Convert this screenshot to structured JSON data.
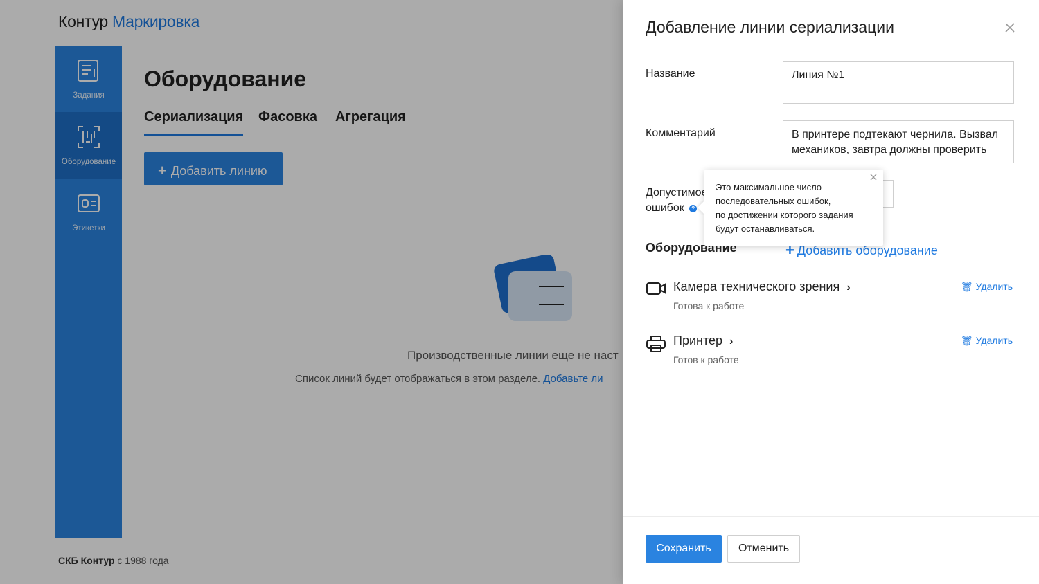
{
  "background": {
    "logo": {
      "brand": "Контур",
      "product": "Маркировка"
    },
    "sidebar": {
      "items": [
        {
          "label": "Задания",
          "icon": "tasks-icon"
        },
        {
          "label": "Оборудование",
          "icon": "equipment-icon"
        },
        {
          "label": "Этикетки",
          "icon": "labels-icon"
        }
      ],
      "active_index": 1
    },
    "page_title": "Оборудование",
    "tabs": [
      {
        "label": "Сериализация"
      },
      {
        "label": "Фасовка"
      },
      {
        "label": "Агрегация"
      }
    ],
    "add_line_button": "Добавить линию",
    "empty_state": {
      "title": "Производственные линии еще не наст",
      "subtitle": "Список линий будет отображаться в этом разделе.",
      "link": "Добавьте ли"
    },
    "footer": {
      "company": "СКБ Контур",
      "since": "с 1988 года"
    }
  },
  "panel": {
    "title": "Добавление линии сериализации",
    "fields": {
      "name": {
        "label": "Название",
        "value": "Линия №1"
      },
      "comment": {
        "label": "Комментарий",
        "value": "В принтере подтекают чернила. Вызвал механиков, завтра должны проверить"
      },
      "errors": {
        "label_line1": "Допустимое",
        "label_line2": "ошибок",
        "help_glyph": "?"
      }
    },
    "tooltip": {
      "lines": [
        "Это максимальное число",
        "последовательных ошибок,",
        "по достижении которого задания",
        "будут останавливаться."
      ]
    },
    "equipment": {
      "section_title": "Оборудование",
      "add_label": "Добавить оборудование",
      "items": [
        {
          "name": "Камера технического зрения",
          "status": "Готова к работе",
          "delete_label": "Удалить",
          "icon": "camera-icon"
        },
        {
          "name": "Принтер",
          "status": "Готов к работе",
          "delete_label": "Удалить",
          "icon": "printer-icon"
        }
      ]
    },
    "buttons": {
      "save": "Сохранить",
      "cancel": "Отменить"
    }
  },
  "colors": {
    "accent": "#1f7ae0",
    "sidebar": "#2a83e0",
    "sidebar_active": "#1e6fc6"
  }
}
